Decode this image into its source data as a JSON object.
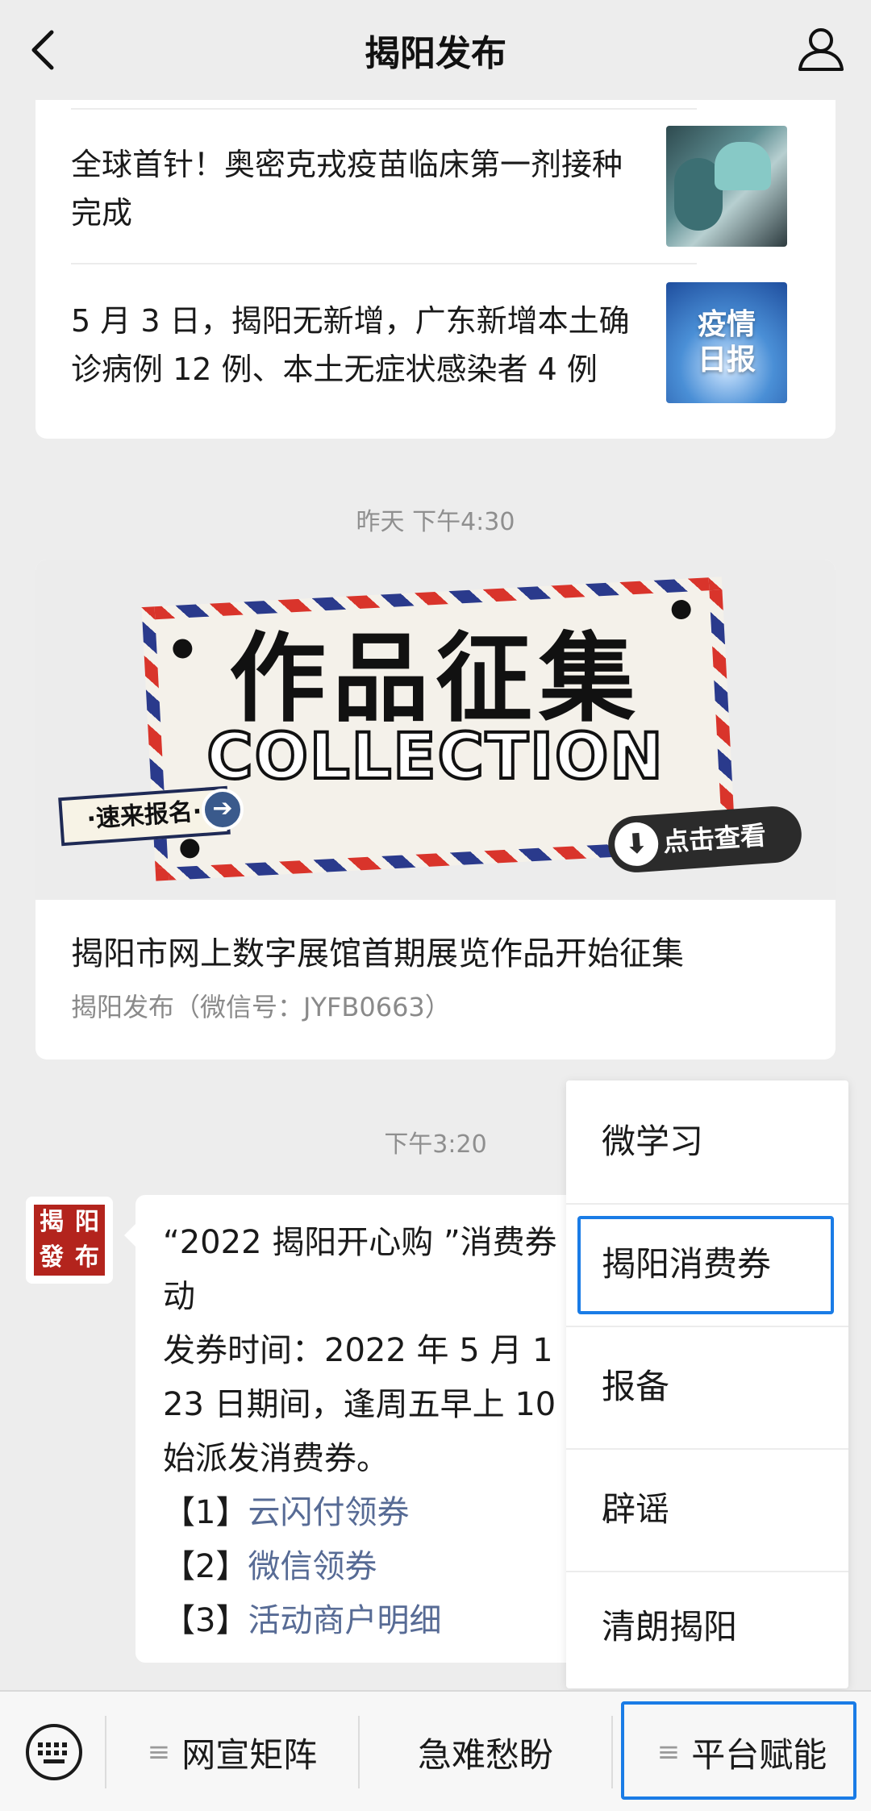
{
  "header": {
    "title": "揭阳发布"
  },
  "articles_group1": [
    {
      "title_line1": "全球首针！奥密克戎疫苗临床第一剂接种",
      "title_line2": "完成"
    },
    {
      "title_line1": "5 月 3 日，揭阳无新增，广东新增本土确",
      "title_line2": "诊病例 12 例、本土无症状感染者 4 例",
      "thumb_text_1": "疫情",
      "thumb_text_2": "日报"
    }
  ],
  "timestamps": {
    "t1": "昨天 下午4:30",
    "t2": "下午3:20"
  },
  "article2": {
    "banner_title": "作品征集",
    "banner_sub": "COLLECTION",
    "banner_tag_left": "·速来报名·",
    "banner_tag_right": "点击查看",
    "headline": "揭阳市网上数字展馆首期展览作品开始征集",
    "source": "揭阳发布（微信号：JYFB0663）"
  },
  "message": {
    "avatar_text": [
      "揭",
      "阳",
      "發",
      "布"
    ],
    "lines": [
      "“2022 揭阳开心购 ”消费券",
      "动",
      "发券时间：2022 年 5 月 1",
      "23 日期间，逢周五早上 10",
      "始派发消费券。"
    ],
    "links": [
      {
        "prefix": "【1】",
        "text": "云闪付领券"
      },
      {
        "prefix": "【2】",
        "text": "微信领券"
      },
      {
        "prefix": "【3】",
        "text": "活动商户明细"
      }
    ]
  },
  "popup_menu": {
    "items": [
      "微学习",
      "揭阳消费券",
      "报备",
      "辟谣",
      "清朗揭阳"
    ],
    "selected_index": 1
  },
  "bottom_menu": {
    "items": [
      "网宣矩阵",
      "急难愁盼",
      "平台赋能"
    ],
    "hamburger": "≡",
    "selected_index": 2
  },
  "colors": {
    "background": "#ededed",
    "link": "#576b95",
    "highlight": "#1a7ce6"
  }
}
